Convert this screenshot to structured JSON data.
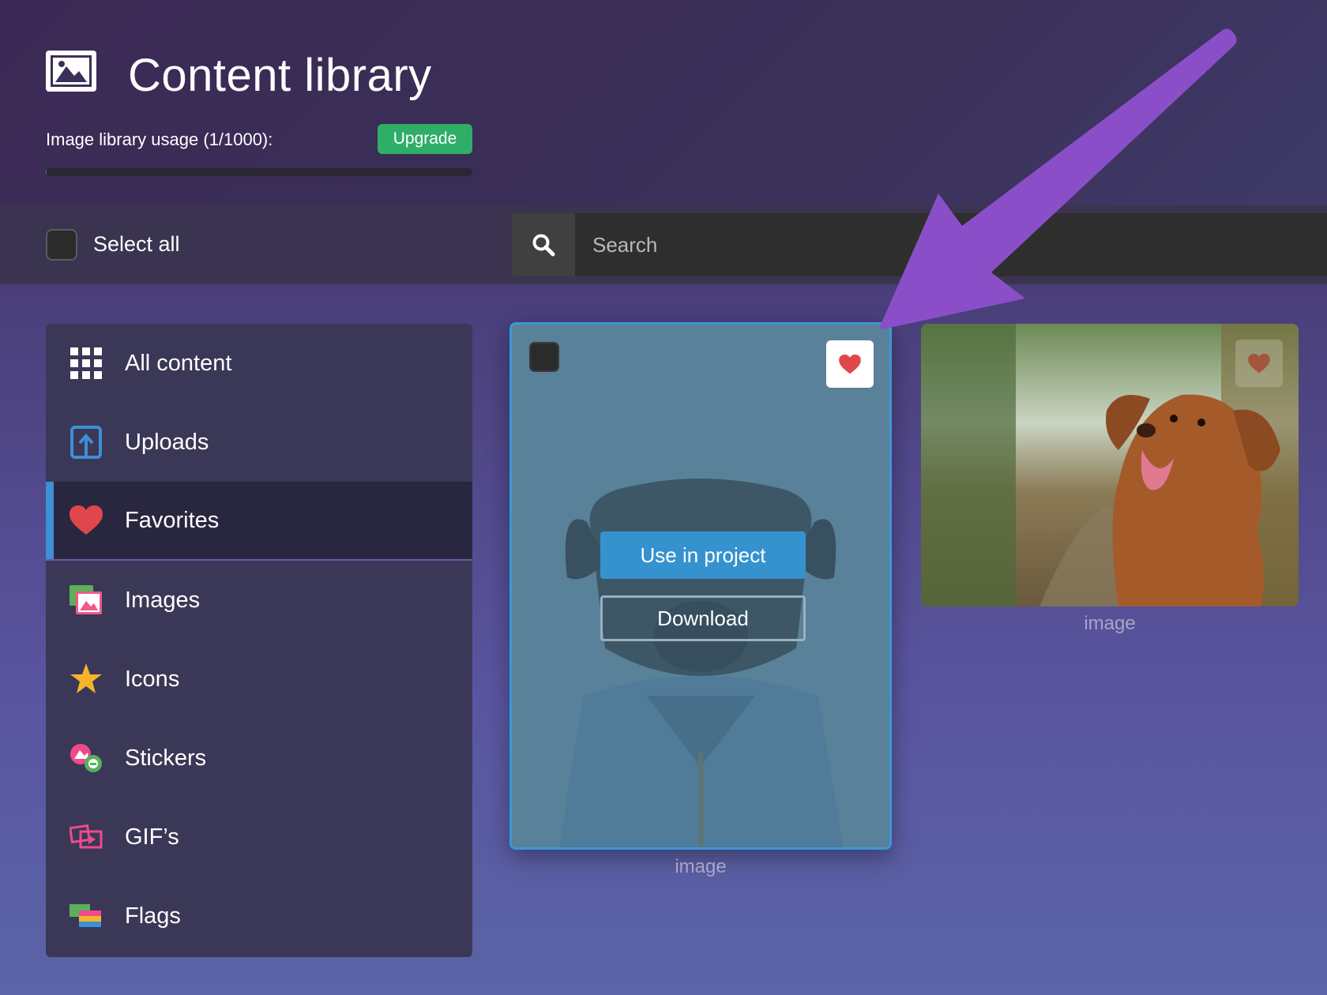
{
  "header": {
    "title": "Content library",
    "usage_label": "Image library usage (1/1000):",
    "usage_fraction": 0.001,
    "upgrade_label": "Upgrade"
  },
  "toolbar": {
    "select_all_label": "Select all",
    "search_placeholder": "Search"
  },
  "sidebar": {
    "items": [
      {
        "label": "All content",
        "icon": "grid-icon"
      },
      {
        "label": "Uploads",
        "icon": "upload-icon"
      },
      {
        "label": "Favorites",
        "icon": "heart-icon",
        "active": true
      },
      {
        "label": "Images",
        "icon": "image-icon"
      },
      {
        "label": "Icons",
        "icon": "star-icon"
      },
      {
        "label": "Stickers",
        "icon": "sticker-icon"
      },
      {
        "label": "GIF’s",
        "icon": "gif-icon"
      },
      {
        "label": "Flags",
        "icon": "flags-icon"
      }
    ]
  },
  "cards": [
    {
      "caption": "image",
      "selected": true,
      "favorited": true,
      "use_label": "Use in project",
      "download_label": "Download"
    },
    {
      "caption": "image",
      "selected": false,
      "favorited": true
    }
  ],
  "colors": {
    "accent_blue": "#3592cf",
    "upgrade_green": "#2fae67",
    "heart_red": "#e0474c",
    "annotation_purple": "#8a4fc8"
  }
}
